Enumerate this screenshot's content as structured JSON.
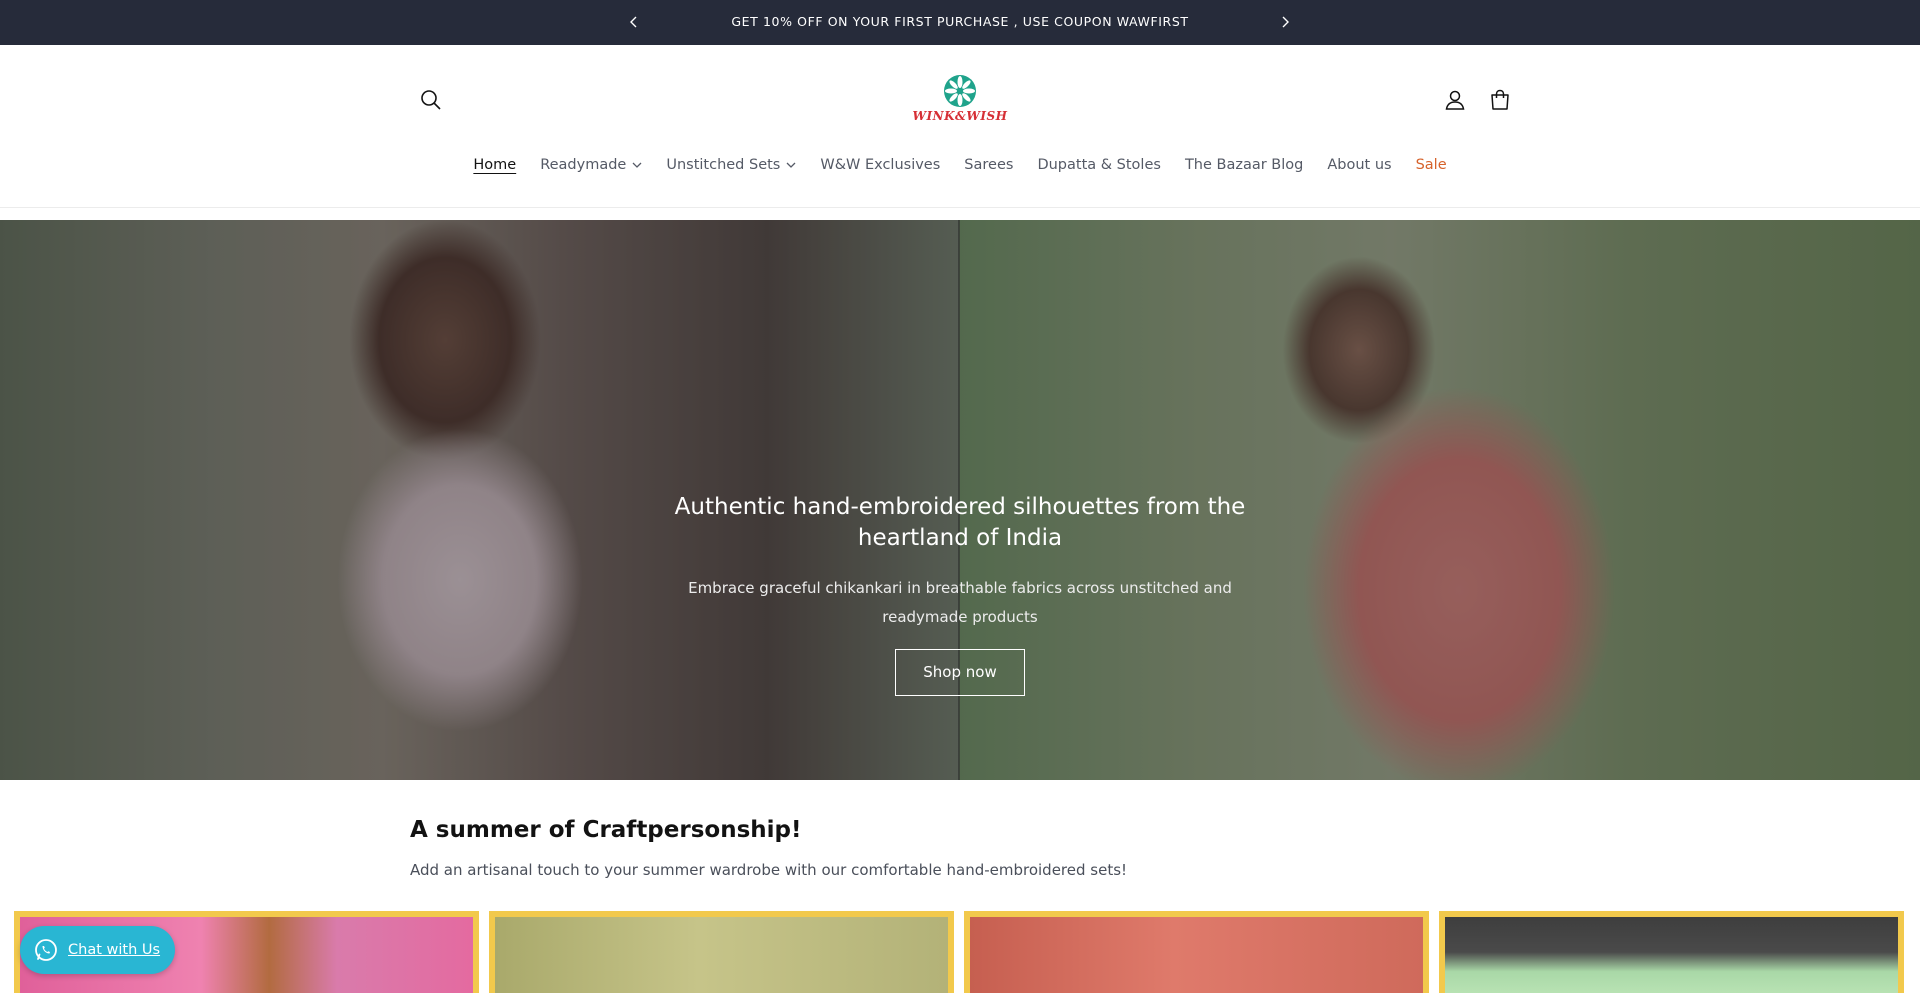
{
  "announcement": {
    "message": "GET 10% OFF ON YOUR FIRST PURCHASE , USE COUPON WAWFIRST",
    "prev_icon": "chevron-left-icon",
    "next_icon": "chevron-right-icon"
  },
  "header": {
    "logo_text": "WINK&WISH",
    "icons": [
      "search-icon",
      "account-icon",
      "cart-icon"
    ]
  },
  "nav": {
    "items": [
      {
        "label": "Home"
      },
      {
        "label": "Readymade"
      },
      {
        "label": "Unstitched Sets"
      },
      {
        "label": "W&W Exclusives"
      },
      {
        "label": "Sarees"
      },
      {
        "label": "Dupatta & Stoles"
      },
      {
        "label": "The Bazaar Blog"
      },
      {
        "label": "About us"
      },
      {
        "label": "Sale"
      }
    ]
  },
  "hero": {
    "title": "Authentic hand-embroidered silhouettes from the heartland of India",
    "subtitle": "Embrace graceful chikankari in breathable fabrics across unstitched and readymade products",
    "button_label": "Shop now"
  },
  "section": {
    "title": "A summer of Craftpersonship!",
    "subtitle": "Add an artisanal touch to your summer wardrobe with our comfortable hand-embroidered sets!"
  },
  "chat": {
    "label": "Chat with Us",
    "icon": "whatsapp-icon"
  },
  "colors": {
    "announcement_bg": "#262b3a",
    "sale": "#d6622b",
    "card_border": "#f2c94c",
    "chat_bg": "#29b6d3"
  }
}
